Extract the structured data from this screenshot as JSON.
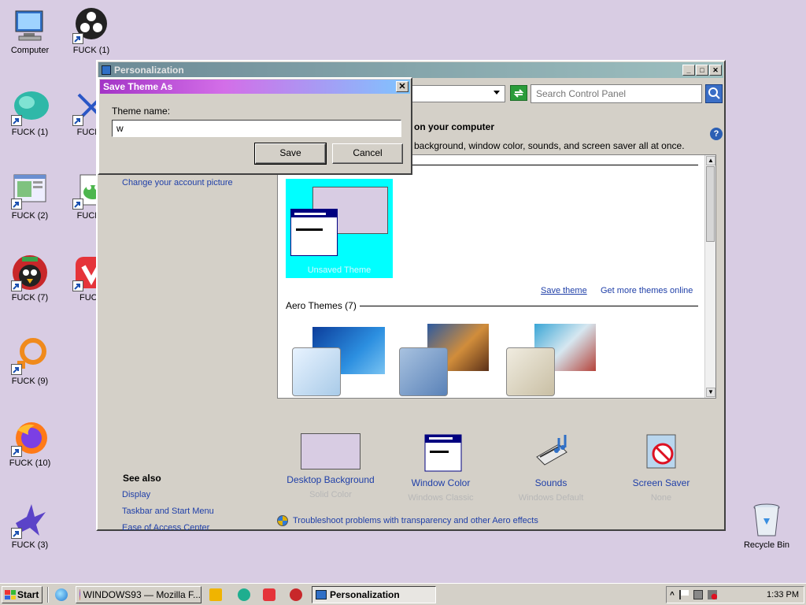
{
  "desktop": {
    "icons": [
      {
        "label": "Computer"
      },
      {
        "label": "FUCK (1)"
      },
      {
        "label": "FUCK (1)"
      },
      {
        "label": "FUCK ("
      },
      {
        "label": "FUCK (2)"
      },
      {
        "label": "FUCK ("
      },
      {
        "label": "FUCK (7)"
      },
      {
        "label": "FUCK"
      },
      {
        "label": "FUCK (9)"
      },
      {
        "label": "FUCK (10)"
      },
      {
        "label": "FUCK (3)"
      },
      {
        "label": "Recycle Bin"
      }
    ]
  },
  "window": {
    "title": "Personalization",
    "search_placeholder": "Search Control Panel",
    "heading": "on your computer",
    "subheading": "background, window color, sounds, and screen saver all at once.",
    "account_link": "Change your account picture",
    "unsaved_theme_label": "Unsaved Theme",
    "save_theme_link": "Save theme",
    "more_themes_link": "Get more themes online",
    "aero_label": "Aero Themes (7)",
    "bottom": [
      {
        "title": "Desktop Background",
        "sub": "Solid Color"
      },
      {
        "title": "Window Color",
        "sub": "Windows Classic"
      },
      {
        "title": "Sounds",
        "sub": "Windows Default"
      },
      {
        "title": "Screen Saver",
        "sub": "None"
      }
    ],
    "see_also_title": "See also",
    "see_also": [
      "Display",
      "Taskbar and Start Menu",
      "Ease of Access Center"
    ],
    "troubleshoot": "Troubleshoot problems with transparency and other Aero effects",
    "help": "?"
  },
  "dialog": {
    "title": "Save Theme As",
    "label": "Theme name:",
    "value": "w",
    "save": "Save",
    "cancel": "Cancel",
    "close": "✕"
  },
  "taskbar": {
    "start": "Start",
    "tasks": [
      {
        "label": "WINDOWS93 — Mozilla F..."
      },
      {
        "label": "Personalization"
      }
    ],
    "clock": "1:33 PM"
  },
  "colors": {
    "desktop": "#d8cce3",
    "selected_theme": "#00ffff",
    "link": "#1f3fa8"
  }
}
